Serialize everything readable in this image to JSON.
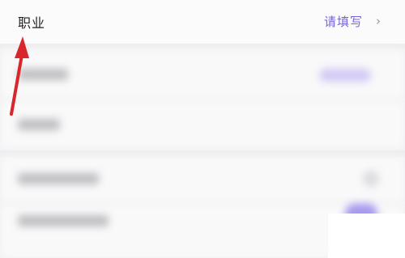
{
  "occupation_row": {
    "label": "职业",
    "value": "请填写",
    "chevron": "›"
  },
  "icons": {
    "chevron": "chevron-right-icon",
    "annotation_arrow": "red-arrow-icon"
  },
  "colors": {
    "accent": "#7a64d8",
    "annotation": "#d9262b"
  }
}
